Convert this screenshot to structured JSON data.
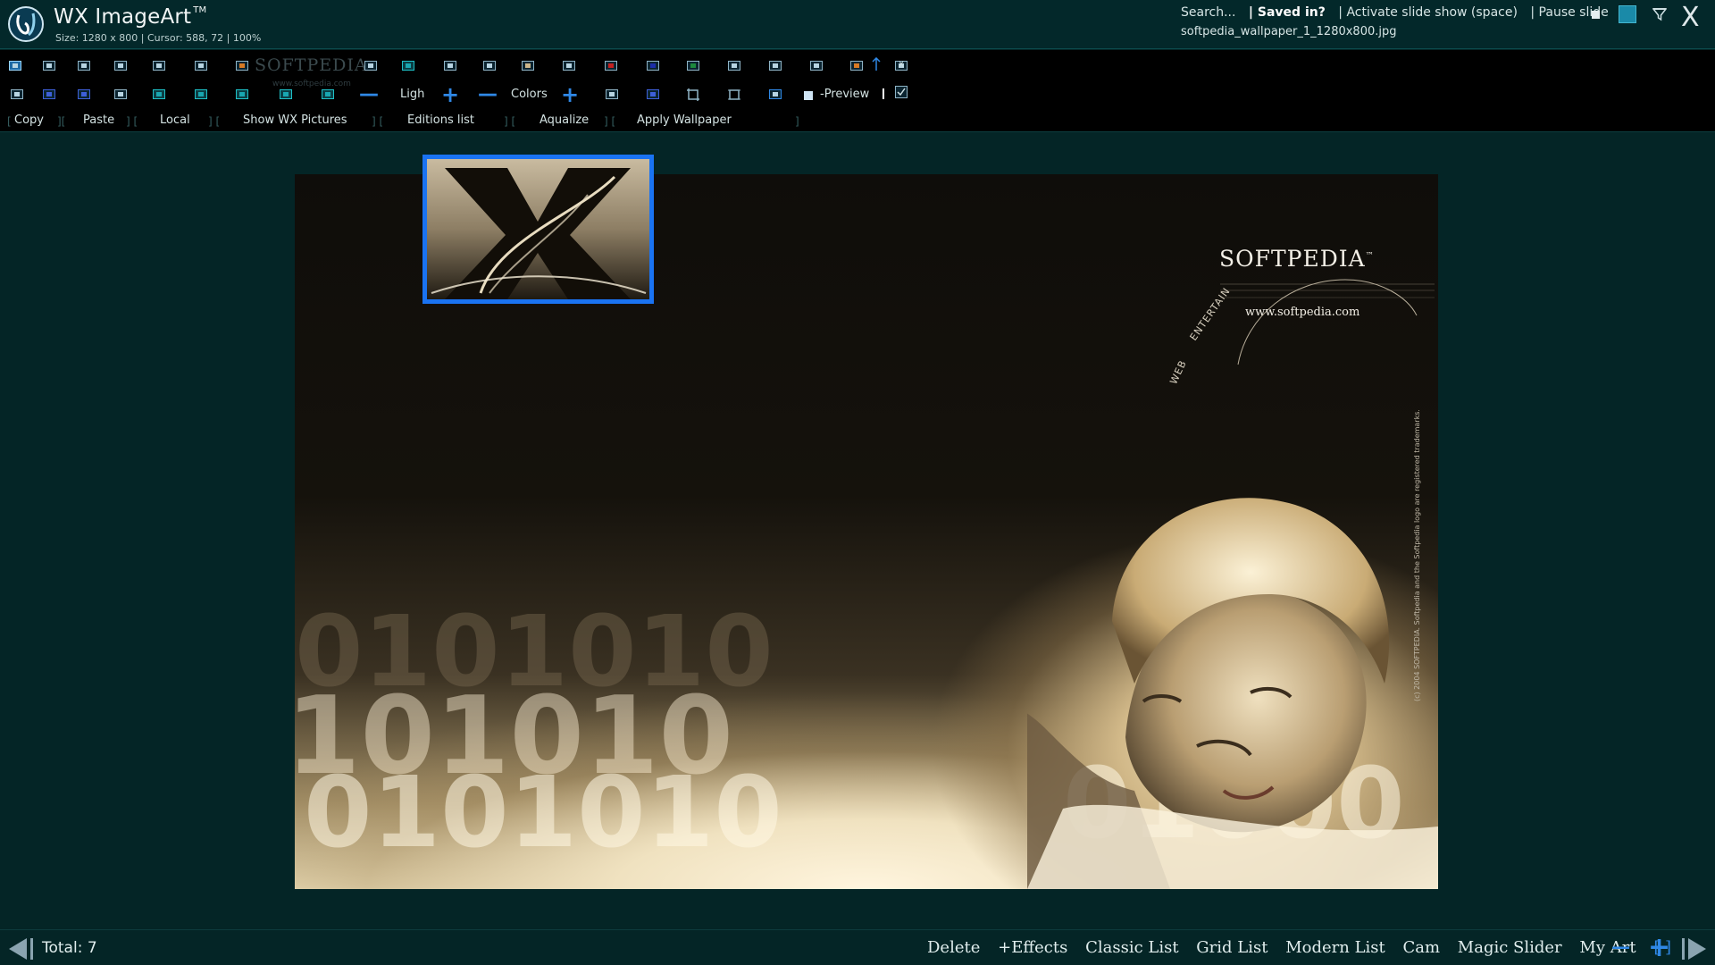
{
  "app": {
    "title": "WX ImageArt",
    "trademark": "TM",
    "info": "Size: 1280 x 800 | Cursor: 588, 72 | 100%"
  },
  "top_links": {
    "search": "Search...",
    "saved": "| Saved in?",
    "slideshow": "| Activate slide show (space)",
    "pause": "| Pause slide"
  },
  "filename": "softpedia_wallpaper_1_1280x800.jpg",
  "toolbar": {
    "watermark": "SOFTPEDIA",
    "watermark_sub": "www.softpedia.com",
    "ligh_label": "Ligh",
    "colors_label": "Colors",
    "preview_label": "-Preview",
    "close_label": "X",
    "copy": "Copy",
    "paste": "Paste",
    "local": "Local",
    "show_wx": "Show WX Pictures",
    "editions": "Editions list",
    "aqualize": "Aqualize",
    "apply_wallpaper": "Apply Wallpaper"
  },
  "wallpaper": {
    "logo": "SOFTPEDIA",
    "tm": "™",
    "url": "www.softpedia.com",
    "web": "WEB",
    "entertain": "ENTERTAIN",
    "copyright": "(c) 2004 SOFTPEDIA. Softpedia and the Softpedia logo are registered trademarks."
  },
  "bottom": {
    "total": "Total: 7",
    "delete": "Delete",
    "effects": "+Effects",
    "classic_list": "Classic List",
    "grid_list": "Grid List",
    "modern_list": "Modern List",
    "cam": "Cam",
    "magic_slider": "Magic Slider",
    "my_art": "My Art",
    "fullscreen": "[ ]"
  },
  "colors": {
    "background": "#042526",
    "accent_blue": "#2f88e6",
    "thumb_border": "#1a73f2"
  }
}
